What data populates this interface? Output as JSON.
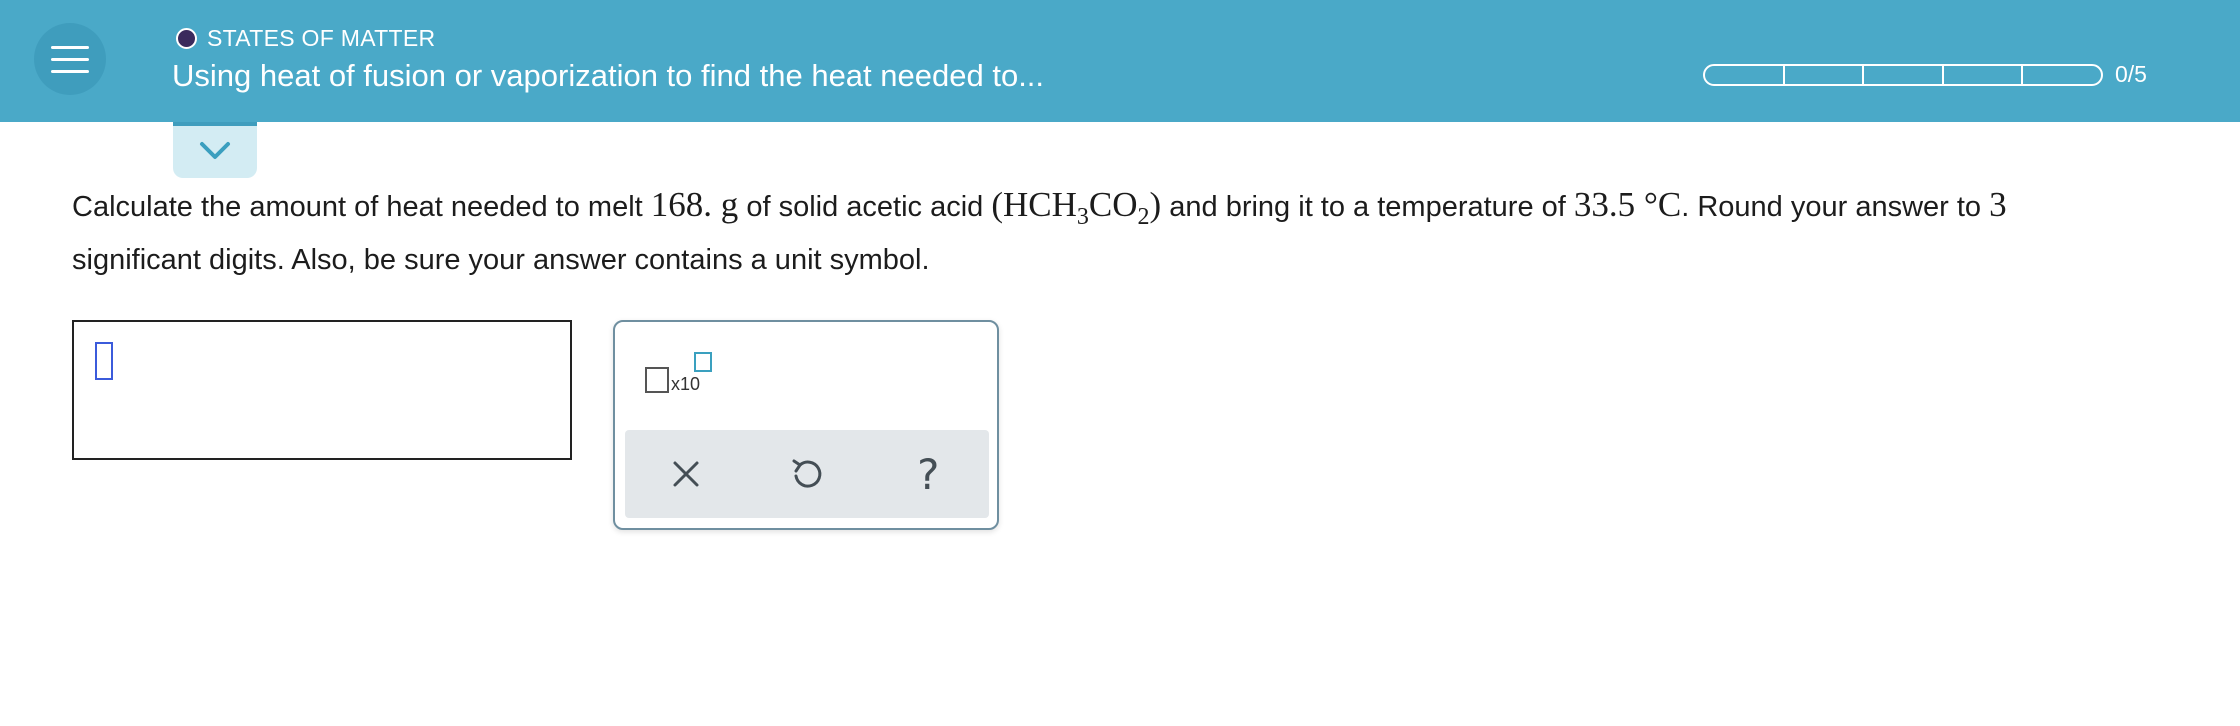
{
  "header": {
    "topic": "STATES OF MATTER",
    "title": "Using heat of fusion or vaporization to find the heat needed to...",
    "progress": {
      "label": "0/5",
      "completed": 0,
      "total": 5
    }
  },
  "question": {
    "p1": "Calculate the amount of heat needed to melt ",
    "mass": "168.",
    "unit_g": "g",
    "p2": " of solid acetic acid ",
    "formula_open": "(HCH",
    "sub1": "3",
    "formula_mid": "CO",
    "sub2": "2",
    "formula_close": ")",
    "p3": " and bring it to a temperature of ",
    "temp": "33.5 °C",
    "p4": ". Round your answer to ",
    "digits": "3",
    "p5": " significant digits. Also, be sure your answer contains a unit symbol."
  },
  "answer": {
    "value": ""
  },
  "tools": {
    "sci_notation_label": "x10"
  },
  "icons": {
    "menu": "hamburger-icon",
    "collapse": "chevron-down-icon",
    "clear": "close-icon",
    "undo": "undo-icon",
    "help": "help-icon"
  },
  "colors": {
    "header_bg": "#4aa9c8",
    "topic_dot": "#3b2a5c",
    "accent": "#3aa0bf",
    "cursor": "#3b5bdb"
  }
}
